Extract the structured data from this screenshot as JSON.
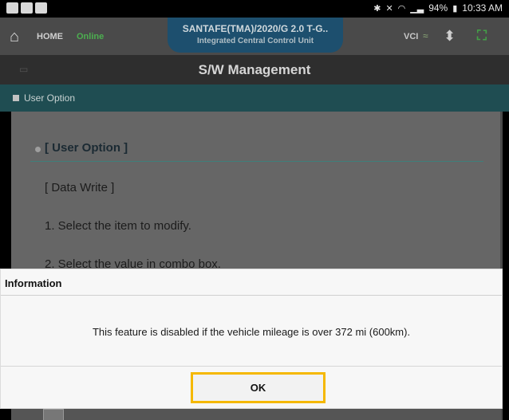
{
  "status_bar": {
    "battery": "94%",
    "time": "10:33 AM",
    "icons": [
      "bluetooth-icon",
      "mute-icon",
      "wifi-icon",
      "signal-icon",
      "battery-icon"
    ]
  },
  "header": {
    "home_label": "HOME",
    "status": "Online",
    "vehicle_name": "SANTAFE(TMA)/2020/G 2.0 T-G..",
    "system": "Integrated Central Control Unit",
    "vci_label": "VCI",
    "accent_green": "#4caf50"
  },
  "page": {
    "title": "S/W Management"
  },
  "section": {
    "label": "User Option"
  },
  "content": {
    "heading": "[ User Option ]",
    "lines": [
      "[ Data Write ]",
      "1. Select the item to modify.",
      "2. Select the value in combo box."
    ]
  },
  "dialog": {
    "title": "Information",
    "message": "This feature is disabled if the vehicle mileage is over 372 mi (600km).",
    "ok_label": "OK",
    "highlight_color": "#f5b800"
  }
}
